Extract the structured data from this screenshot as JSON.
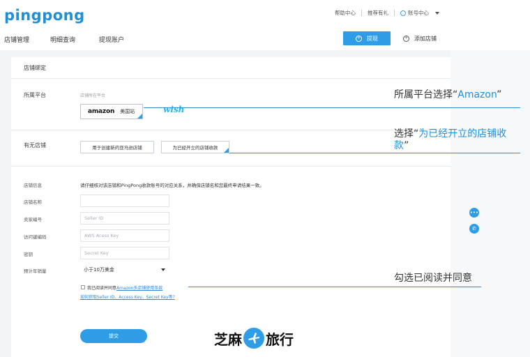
{
  "header": {
    "logo": "pingpong",
    "help": "帮助中心",
    "recommend": "推荐有礼",
    "account": "账号中心"
  },
  "nav": {
    "items": [
      "店铺管理",
      "明细查询",
      "提现账户"
    ],
    "withdraw_label": "提现",
    "add_store_label": "添加店铺"
  },
  "form": {
    "section_title": "店铺绑定",
    "platform_label": "所属平台",
    "platform_hint": "店铺所在平台",
    "amazon_logo": "amazon",
    "amazon_site": "美国站",
    "wish_logo": "wish",
    "has_store_label": "有无店铺",
    "opt_new": "用于创建新的亚马逊店铺",
    "opt_existing": "为已经开立的店铺收款",
    "info_label": "店铺信息",
    "info_note": "请仔细核对该店铺和PingPong收款账号的对应关系，并确保店铺名和您最终申请结果一致。",
    "store_name_label": "店铺名称",
    "seller_id_label": "卖家编号",
    "seller_id_placeholder": "Seller ID",
    "access_key_label": "访问键编码",
    "access_key_placeholder": "AWS Acess Key",
    "secret_label": "密钥",
    "secret_placeholder": "Secret Key",
    "sales_label": "预计年销量",
    "sales_value": "小于10万美金",
    "agree_prefix": "我已阅读并同意",
    "agree_link": "Amazon多店铺使用条款",
    "howto_link": "如何获取Seller ID、Access Key、Secret Key等?",
    "submit_label": "提交"
  },
  "annotations": {
    "note1_prefix": "所属平台选择“",
    "note1_hl": "Amazon",
    "note1_suffix": "”",
    "note2_prefix": "选择“",
    "note2_hl": "为已经开立的店铺收",
    "note2_line2_hl": "款",
    "note2_suffix": "”",
    "note3": "勾选已阅读并同意"
  },
  "watermark": {
    "left": "芝麻",
    "right": "旅行"
  },
  "colors": {
    "accent": "#2e9de6",
    "link": "#2e86d9"
  }
}
